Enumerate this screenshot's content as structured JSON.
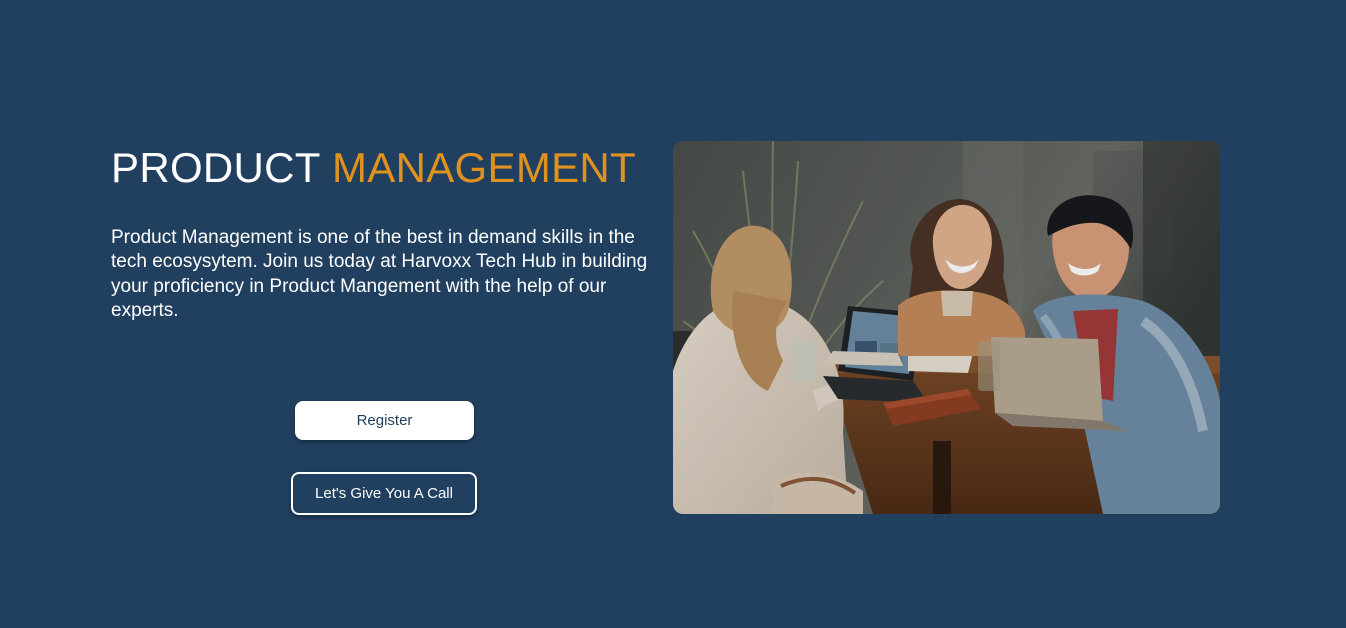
{
  "hero": {
    "title_main": "PRODUCT",
    "title_accent": "MANAGEMENT",
    "description": "Product Management is one of the best in demand skills in the tech ecosysytem. Join us today at Harvoxx Tech Hub in building your proficiency in Product Mangement with the help of our experts.",
    "register_label": "Register",
    "call_label": "Let's Give You A Call",
    "image_alt": "Three people laughing around a wooden table with laptops"
  },
  "colors": {
    "background": "#21405f",
    "accent": "#e0921f",
    "text": "#ffffff"
  }
}
